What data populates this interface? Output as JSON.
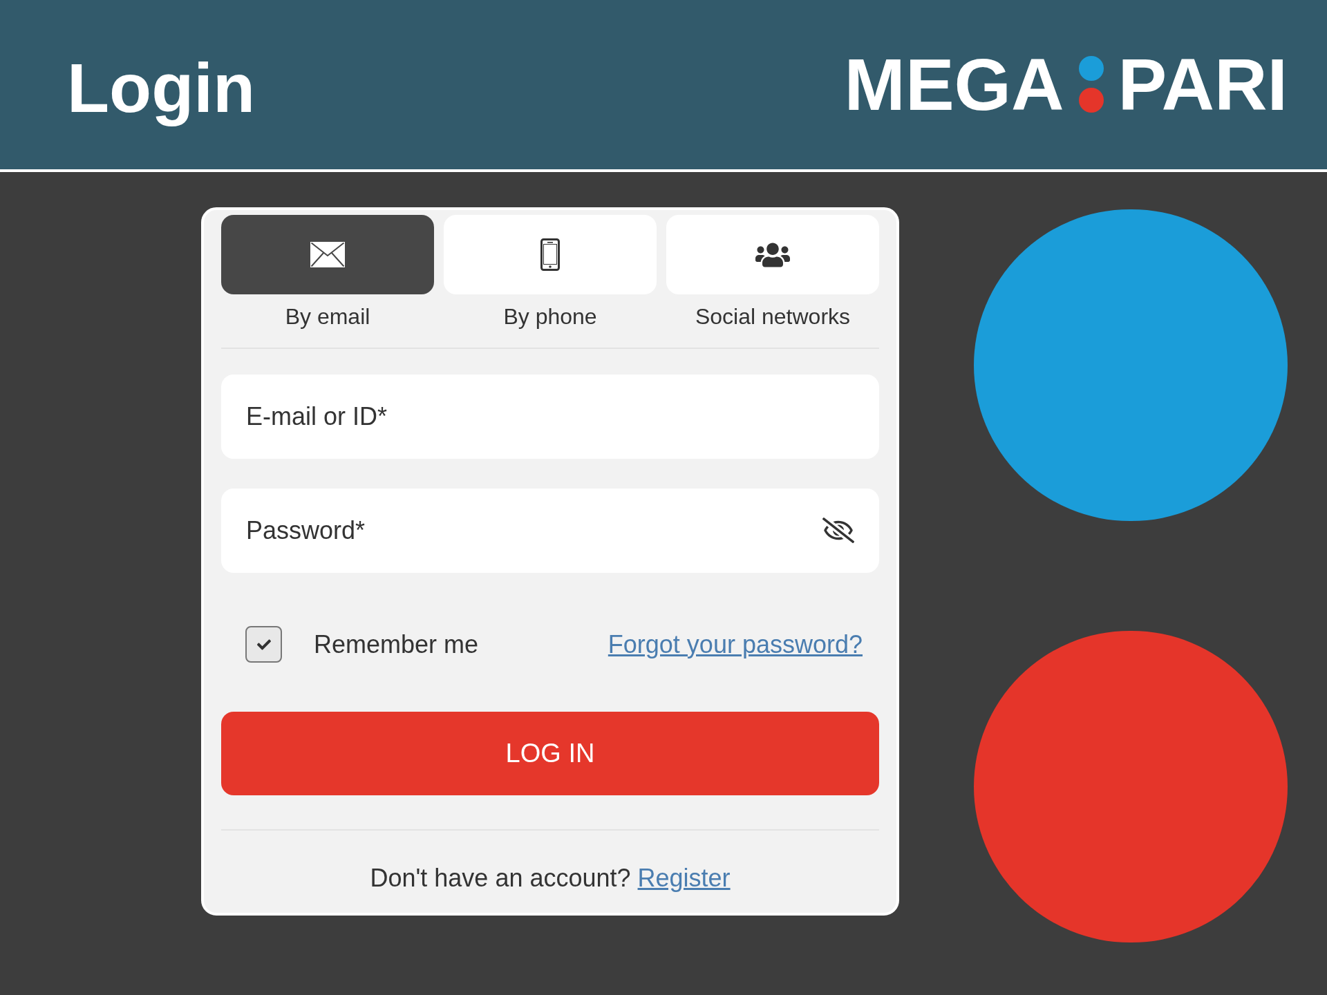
{
  "header": {
    "title": "Login",
    "logo": {
      "left_text": "MEGA",
      "right_text": "PARI"
    }
  },
  "login_form": {
    "tabs": [
      {
        "kind": "email",
        "label": "By email",
        "selected": true
      },
      {
        "kind": "phone",
        "label": "By phone",
        "selected": false
      },
      {
        "kind": "social",
        "label": "Social networks",
        "selected": false
      }
    ],
    "fields": [
      {
        "kind": "text",
        "placeholder": "E-mail or ID*"
      },
      {
        "kind": "password",
        "placeholder": "Password*"
      }
    ],
    "remember_me": {
      "label": "Remember me",
      "checked": true
    },
    "forgot_password_link": "Forgot your password?",
    "submit_button": "LOG IN",
    "register_prompt": {
      "text": "Don't have an account?",
      "link": "Register"
    }
  },
  "decor_circles": [
    {
      "color": "#1b9dd9"
    },
    {
      "color": "#e5352a"
    }
  ]
}
